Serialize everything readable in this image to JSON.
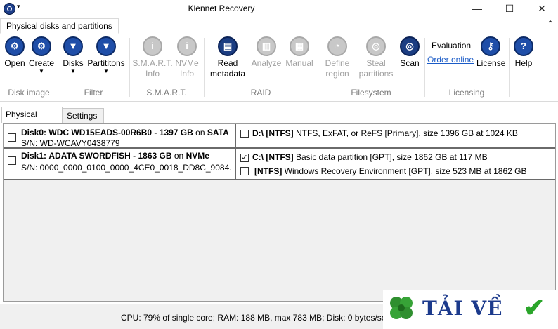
{
  "window": {
    "title": "Klennet Recovery",
    "minimize_glyph": "—",
    "maximize_glyph": "☐",
    "close_glyph": "✕",
    "sysmenu_glyph": "▾"
  },
  "ribbon": {
    "tab": "Physical disks and partitions",
    "collapse_glyph": "⌃",
    "buttons": {
      "open": "Open",
      "create": "Create",
      "disks": "Disks",
      "partitions": "Partititons",
      "smart_info": [
        "S.M.A.R.T.",
        "Info"
      ],
      "nvme_info": [
        "NVMe",
        "Info"
      ],
      "read_metadata": [
        "Read",
        "metadata"
      ],
      "analyze": "Analyze",
      "manual": "Manual",
      "define_region": [
        "Define",
        "region"
      ],
      "steal_partitions": [
        "Steal",
        "partitions"
      ],
      "scan": "Scan",
      "evaluation": "Evaluation",
      "order_online": "Order online",
      "license": "License",
      "help": "Help"
    },
    "groups": {
      "disk_image": "Disk image",
      "filter": "Filter",
      "smart": "S.M.A.R.T.",
      "raid": "RAID",
      "filesystem": "Filesystem",
      "licensing": "Licensing"
    }
  },
  "view_tabs": [
    "Physical Disks",
    "Settings"
  ],
  "disks": [
    {
      "name": "Disk0:",
      "model": "WDC WD15EADS-00R6B0",
      "size": "1397 GB",
      "on": "on",
      "bus": "SATA",
      "serial": "S/N: WD-WCAVY0438779",
      "checked": false,
      "partitions": [
        {
          "label": "D:\\ [NTFS]",
          "desc": "NTFS, ExFAT, or ReFS [Primary], size 1396 GB at 1024 KB",
          "checked": false
        }
      ]
    },
    {
      "name": "Disk1:",
      "model": "ADATA SWORDFISH",
      "size": "1863 GB",
      "on": "on",
      "bus": "NVMe",
      "serial": "S/N: 0000_0000_0100_0000_4CE0_0018_DD8C_9084.",
      "checked": false,
      "partitions": [
        {
          "label": "C:\\ [NTFS]",
          "desc": "Basic data partition [GPT], size 1862 GB at 117 MB",
          "checked": true
        },
        {
          "label": "[NTFS]",
          "desc": "Windows Recovery Environment [GPT], size 523 MB at 1862 GB",
          "checked": false
        }
      ]
    }
  ],
  "status": "CPU: 79% of single core; RAM: 188 MB, max 783 MB; Disk: 0 bytes/sec,",
  "watermark": "TẢI VỀ",
  "colors": {
    "accent": "#1f4ea8",
    "link": "#1a5bc7",
    "disabled": "#a0a0a0",
    "check": "#2aa52a"
  }
}
